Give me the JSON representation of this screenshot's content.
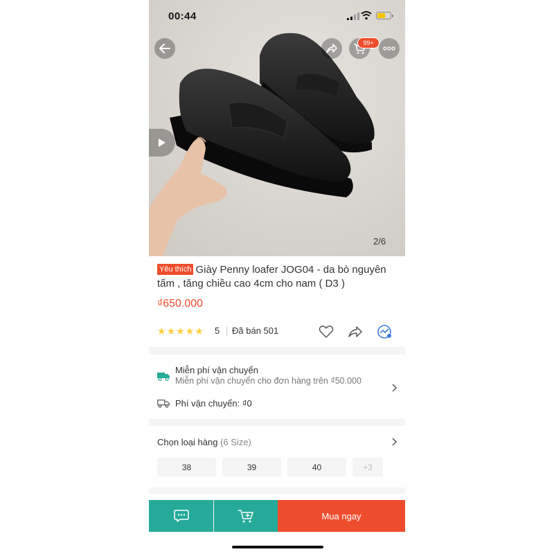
{
  "status_bar": {
    "time": "00:44"
  },
  "gallery": {
    "counter": "2/6",
    "cart_badge": "99+"
  },
  "product": {
    "tag": "Yêu thích",
    "title": "Giày Penny loafer JOG04 - da bò nguyên tấm , tăng chiều cao 4cm cho nam ( D3 )",
    "price": "₫650.000",
    "rating": {
      "stars": 5,
      "value": "5"
    },
    "sold": "Đã bán 501"
  },
  "shipping": {
    "title": "Miễn phí vận chuyển",
    "subtitle": "Miễn phí vận chuyển cho đơn hàng trên ₫50.000",
    "fee": "Phí vận chuyển: ₫0"
  },
  "variants": {
    "title": "Chọn loại hàng",
    "count": "(6 Size)",
    "options": [
      "38",
      "39",
      "40",
      "+3"
    ]
  },
  "bottom_bar": {
    "buy_label": "Mua ngay"
  },
  "colors": {
    "accent": "#ee4d2d",
    "teal": "#26aa99",
    "star": "#ffce3d"
  }
}
